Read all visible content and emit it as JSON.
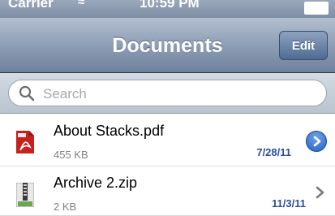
{
  "status_bar": {
    "carrier": "Carrier",
    "wifi_icon": "wifi-icon",
    "time": "10:59 PM",
    "battery_icon": "battery-icon"
  },
  "nav": {
    "title": "Documents",
    "edit_label": "Edit"
  },
  "search": {
    "placeholder": "Search",
    "icon": "search-icon"
  },
  "files": [
    {
      "name": "About Stacks.pdf",
      "size": "455 KB",
      "date": "7/28/11",
      "icon": "pdf-file-icon",
      "accessory": "detail-disclosure-button"
    },
    {
      "name": "Archive 2.zip",
      "size": "2 KB",
      "date": "11/3/11",
      "icon": "zip-file-icon",
      "accessory": "chevron-right-icon"
    }
  ],
  "colors": {
    "nav_bar": "#8e9eb5",
    "accent_blue": "#2563c3",
    "date_text": "#2d4e9a",
    "pdf_red": "#c8201c"
  }
}
